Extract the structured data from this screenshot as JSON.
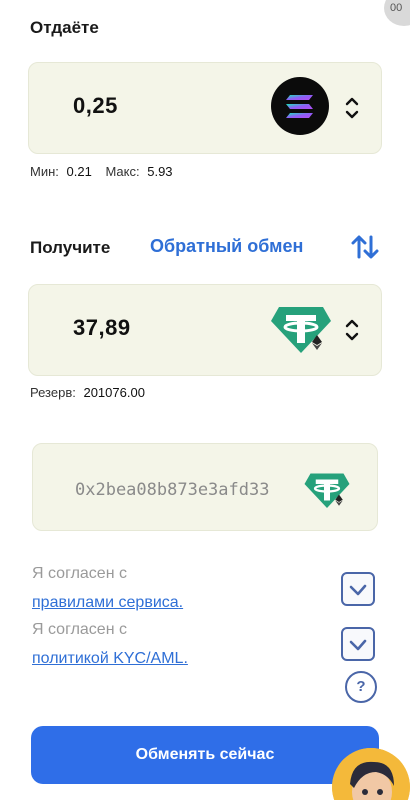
{
  "give": {
    "label": "Отдаёте",
    "amount": "0,25",
    "coin_icon": "solana-icon",
    "min_label": "Мин:",
    "min_value": "0.21",
    "max_label": "Макс:",
    "max_value": "5.93"
  },
  "receive": {
    "label": "Получите",
    "reverse_label": "Обратный обмен",
    "amount": "37,89",
    "coin_icon": "tether-erc20-icon",
    "reserve_label": "Резерв:",
    "reserve_value": "201076.00"
  },
  "address": {
    "value": "0x2bea08b873e3afd33",
    "coin_icon": "tether-erc20-icon"
  },
  "agreements": {
    "rules_prefix": "Я согласен с",
    "rules_link": "правилами сервиса",
    "kyc_prefix": "Я согласен с",
    "kyc_link": "политикой KYC/AML"
  },
  "help_label": "?",
  "submit_label": "Обменять сейчас",
  "corner_badge": "00",
  "colors": {
    "accent": "#2f6ee8",
    "link": "#2f6fd6",
    "card_bg": "#f4f5e8",
    "tether": "#26a17b"
  }
}
